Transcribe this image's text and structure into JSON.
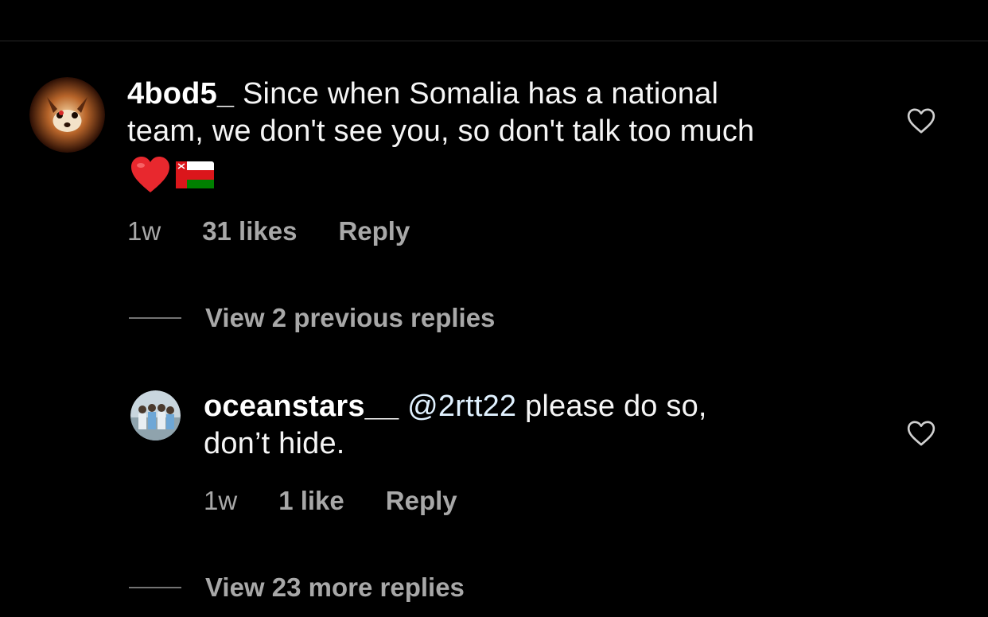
{
  "comments": [
    {
      "username": "4bod5_",
      "text_line1": "Since when Somalia has a national",
      "text_line2": "team, we don't see you, so don't talk too much",
      "emojis": [
        "red-heart",
        "oman-flag"
      ],
      "time": "1w",
      "likes": "31 likes",
      "reply": "Reply"
    }
  ],
  "view_previous": "View 2 previous replies",
  "replies": [
    {
      "username": "oceanstars__",
      "mention": "@2rtt22",
      "text_after_mention": " please do so,",
      "text_line2": "don’t hide.",
      "time": "1w",
      "likes": "1 like",
      "reply": "Reply"
    }
  ],
  "view_more": "View 23 more replies",
  "colors": {
    "background": "#000000",
    "primary_text": "#ffffff",
    "secondary_text": "#a8a8a8",
    "mention": "#e0f1ff",
    "divider": "#262626"
  },
  "icons": {
    "like": "heart-outline-icon"
  }
}
